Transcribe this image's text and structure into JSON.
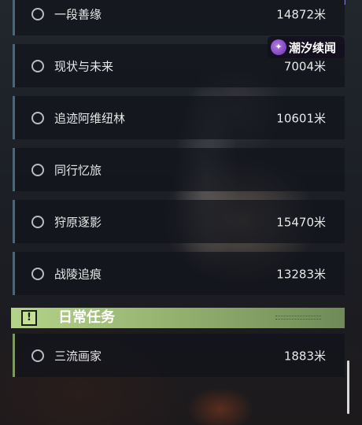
{
  "logo": {
    "text": "潮汐续闻"
  },
  "quests": [
    {
      "title": "一段善缘",
      "distance": "14872米"
    },
    {
      "title": "现状与未来",
      "distance": "7004米"
    },
    {
      "title": "追迹阿维纽林",
      "distance": "10601米"
    },
    {
      "title": "同行忆旅",
      "distance": ""
    },
    {
      "title": "狩原逐影",
      "distance": "15470米"
    },
    {
      "title": "战陵追痕",
      "distance": "13283米"
    }
  ],
  "daily_section": {
    "label": "日常任务",
    "warning_icon": "!"
  },
  "daily_quests": [
    {
      "title": "三流画家",
      "distance": "1883米"
    }
  ],
  "colors": {
    "main_bar": "#4d6577",
    "daily_bar": "#7d9a5a",
    "daily_header": "#a8c67f",
    "logo_purple": "#8a4fd0"
  }
}
